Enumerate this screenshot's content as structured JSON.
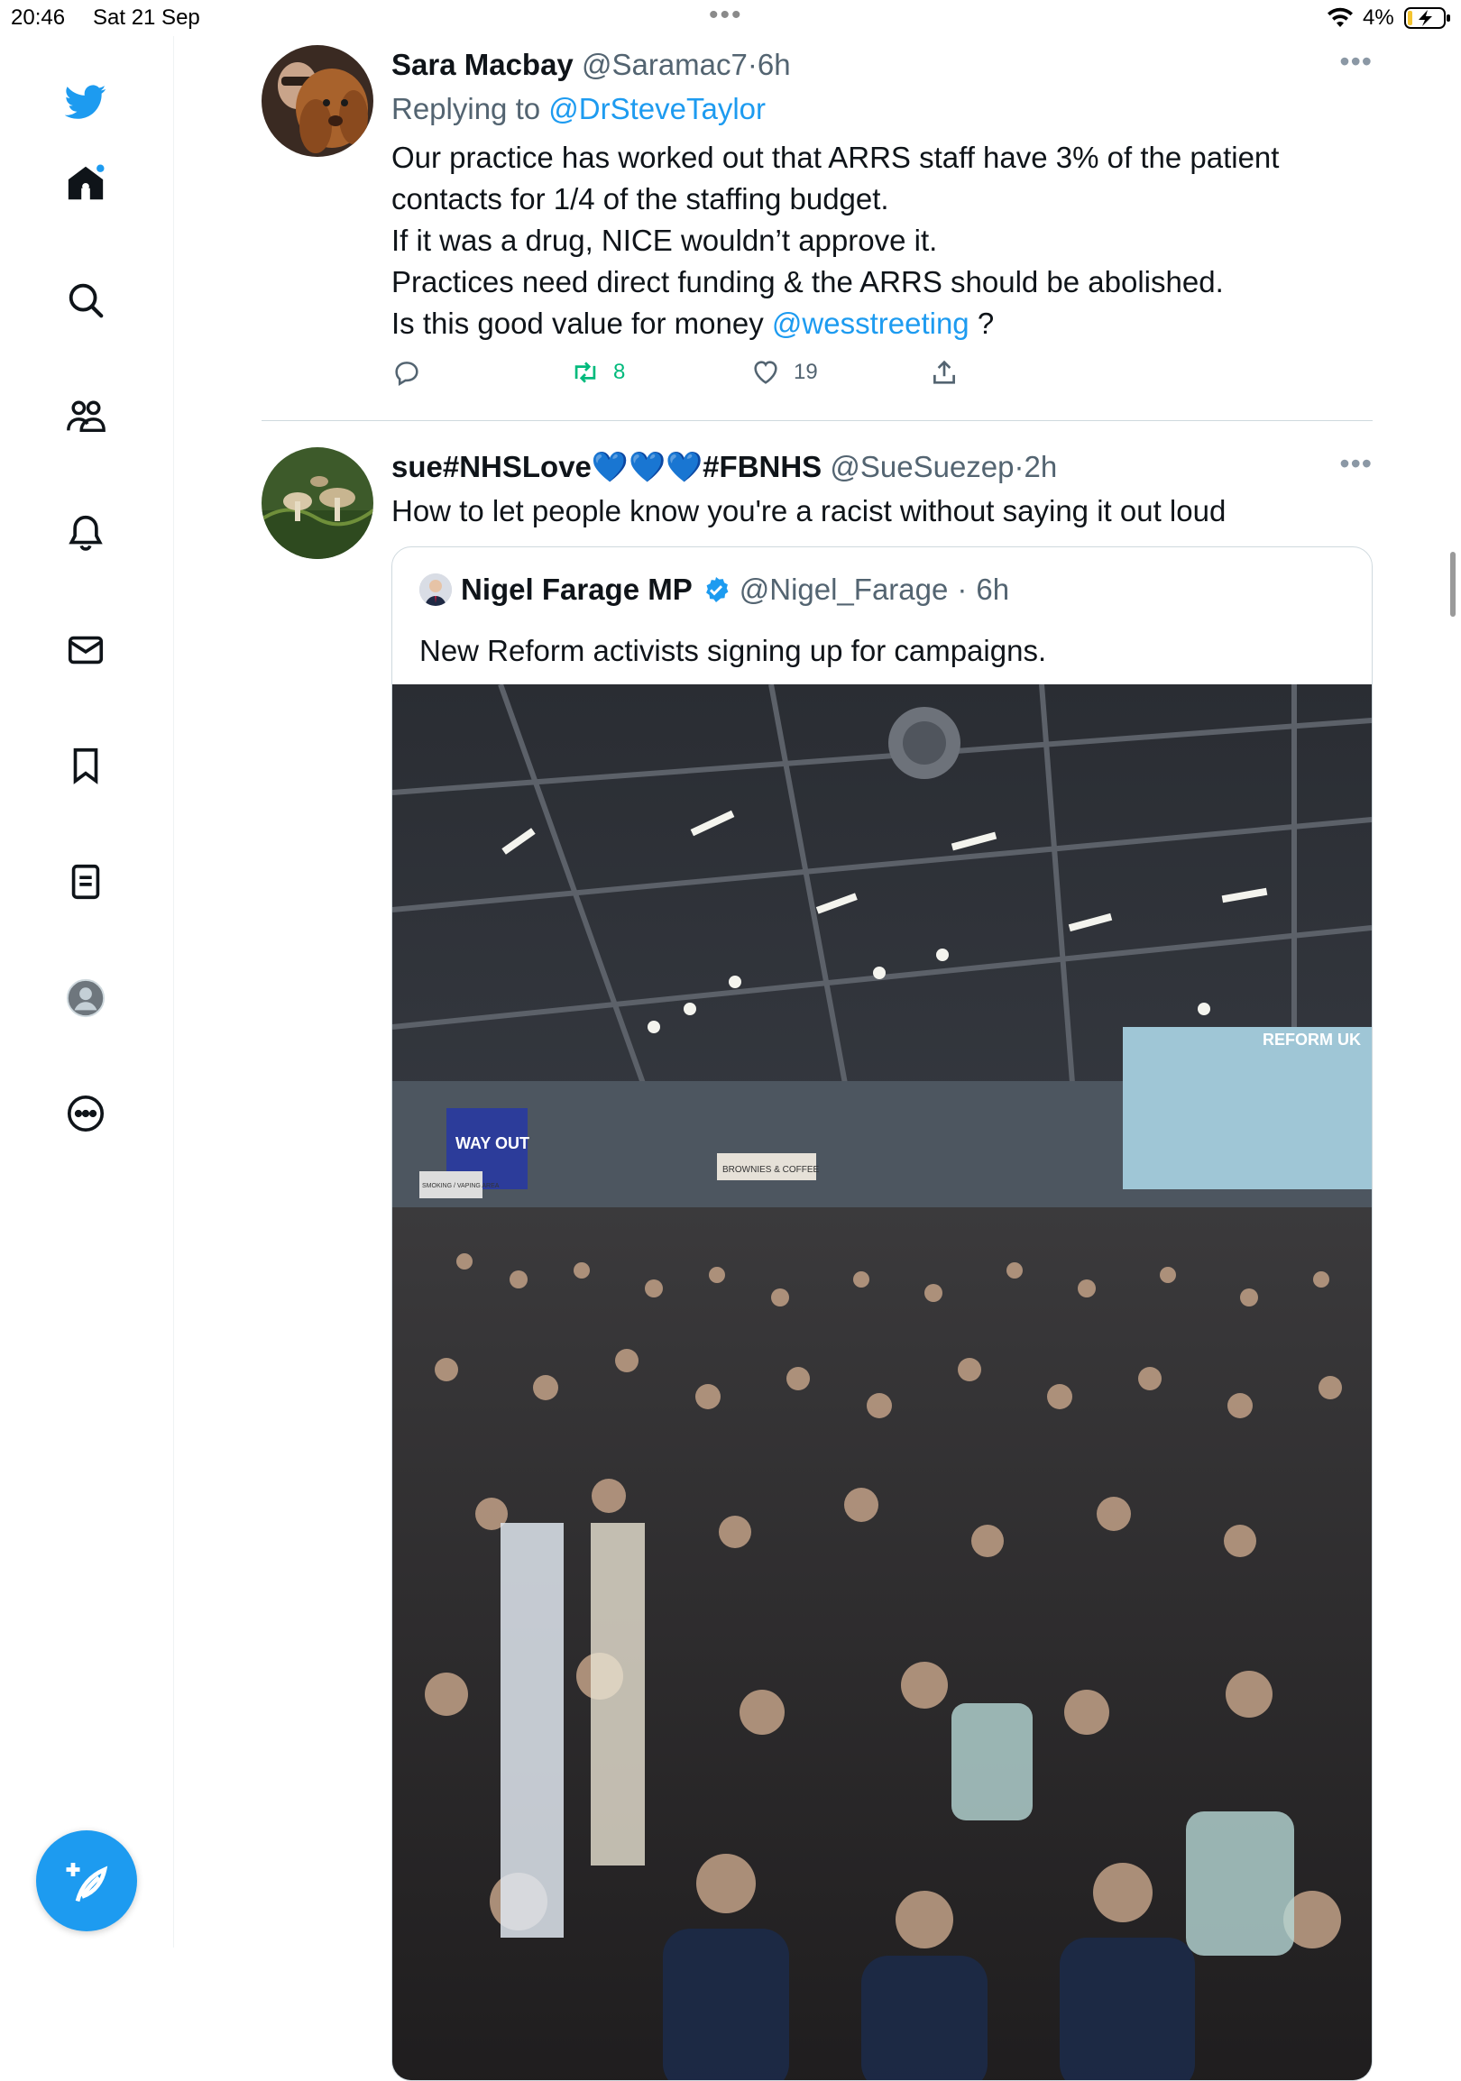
{
  "status_bar": {
    "time": "20:46",
    "date": "Sat 21 Sep",
    "dots": "•••",
    "battery_percent": "4%",
    "icons": [
      "wifi-icon",
      "battery-charging-icon"
    ]
  },
  "sidebar": {
    "items": [
      {
        "name": "twitter-logo-icon"
      },
      {
        "name": "home-icon",
        "badge": "unread-dot"
      },
      {
        "name": "search-icon"
      },
      {
        "name": "communities-icon"
      },
      {
        "name": "notifications-icon"
      },
      {
        "name": "messages-icon"
      },
      {
        "name": "bookmarks-icon"
      },
      {
        "name": "lists-icon"
      },
      {
        "name": "profile-icon"
      },
      {
        "name": "more-icon"
      }
    ],
    "compose_icon": "compose-tweet-icon"
  },
  "tweets": [
    {
      "display_name": "Sara Macbay",
      "handle": "@Saramac7",
      "separator": "·",
      "time_ago": "6h",
      "more": "•••",
      "replying_prefix": "Replying to",
      "replying_to": "@DrSteveTaylor",
      "text_main": "Our practice has worked out that ARRS staff have 3% of the patient contacts for 1/4 of the staffing budget.\nIf it was a drug, NICE wouldn’t approve it.\nPractices need direct funding & the ARRS should be abolished.\nIs this good value for money ",
      "mention": "@wesstreeting",
      "text_end": " ?",
      "retweets": "8",
      "likes": "19",
      "retweet_color": "#00ba7c"
    },
    {
      "display_name": "sue#NHSLove💙💙💙#FBNHS",
      "handle": "@SueSuezep",
      "separator": "·",
      "time_ago": "2h",
      "more": "•••",
      "text": "How to let people know you're a racist without saying it out loud",
      "quote": {
        "display_name": "Nigel Farage MP",
        "handle": "@Nigel_Farage",
        "separator": "·",
        "time_ago": "6h",
        "verified_icon": "verified-badge-icon",
        "text": "New Reform activists signing up for campaigns.",
        "photo_signs": [
          "WAY OUT",
          "REFORM UK",
          "BROWNIES & COFFEE",
          "SMOKING / VAPING AREA"
        ]
      }
    }
  ],
  "colors": {
    "accent": "#1d9bf0",
    "muted": "#536471",
    "retweet": "#00ba7c"
  }
}
